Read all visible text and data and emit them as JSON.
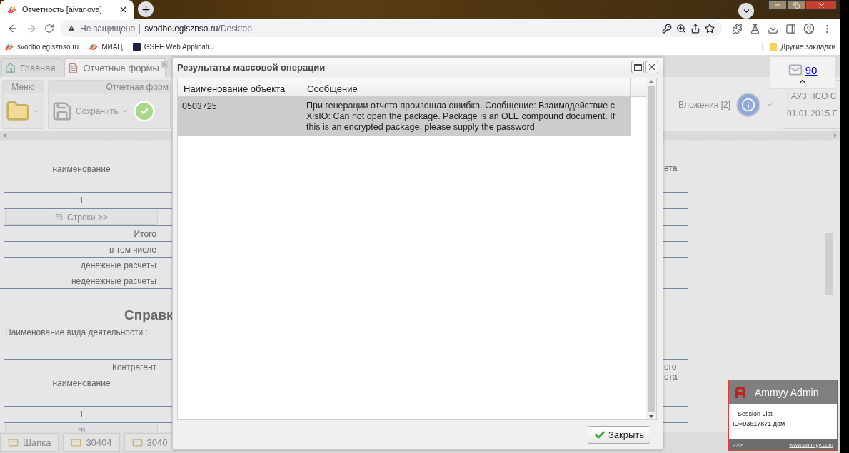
{
  "browser": {
    "tab_title": "Отчетность [aivanova]",
    "security": "Не защищено",
    "host": "svodbo.egisznso.ru",
    "path": "/Desktop",
    "bookmarks": [
      {
        "kind": "stripes",
        "label": "svodbo.egisznso.ru"
      },
      {
        "kind": "stripes",
        "label": "МИАЦ"
      },
      {
        "kind": "square",
        "label": "GSEE Web Applicati..."
      }
    ],
    "other_bookmarks": "Другие закладки"
  },
  "app": {
    "tabs": [
      {
        "label": "Главная",
        "selected": false,
        "closable": false
      },
      {
        "label": "Отчетные формы",
        "selected": true,
        "closable": true
      }
    ],
    "toolbar": {
      "menu_group": "Меню",
      "form_group": "Отчетная форм",
      "save": "Сохранить",
      "attachments": "Вложения [2]",
      "org": "ГАУЗ НСО С",
      "date": "01.01.2015 Г"
    },
    "mail_count": "90",
    "form": {
      "tables": [
        {
          "right_header": [
            "ета"
          ],
          "rows": [
            {
              "kind": "header",
              "text": "наименование"
            },
            {
              "kind": "number",
              "text": "1"
            },
            {
              "kind": "button",
              "text": "Строки >>"
            },
            {
              "kind": "label",
              "text": "Итого"
            },
            {
              "kind": "label",
              "text": "в том числе"
            },
            {
              "kind": "label",
              "text": "денежные расчеты"
            },
            {
              "kind": "label",
              "text": "неденежные расчеты"
            }
          ]
        },
        {
          "right_header": [
            "его",
            "ета"
          ],
          "rows": [
            {
              "kind": "group",
              "text": "Контрагент"
            },
            {
              "kind": "header",
              "text": "наименование"
            },
            {
              "kind": "number",
              "text": "1"
            },
            {
              "kind": "button",
              "text": ""
            }
          ]
        }
      ],
      "heading": "Справк",
      "activity_label": "Наименование вида деятельности :"
    },
    "bottom_tabs": [
      "Шапка",
      "30404",
      "3040"
    ]
  },
  "dialog": {
    "title": "Результаты массовой операции",
    "columns": [
      "Наименование объекта",
      "Сообщение"
    ],
    "rows": [
      {
        "object": "0503725",
        "message": "При генерации отчета произошла ошибка. Сообщение: Взаимодействие с XlsIO: Can not open the package. Package is an OLE compound document. If this is an encrypted package, please supply the password",
        "selected": true
      }
    ],
    "close_button": "Закрыть"
  },
  "ammyy": {
    "title": "Ammyy Admin",
    "session_list": "Session List",
    "session_id": "ID=93617871 дом",
    "more": ">>>",
    "link": "www.ammyy.com"
  }
}
